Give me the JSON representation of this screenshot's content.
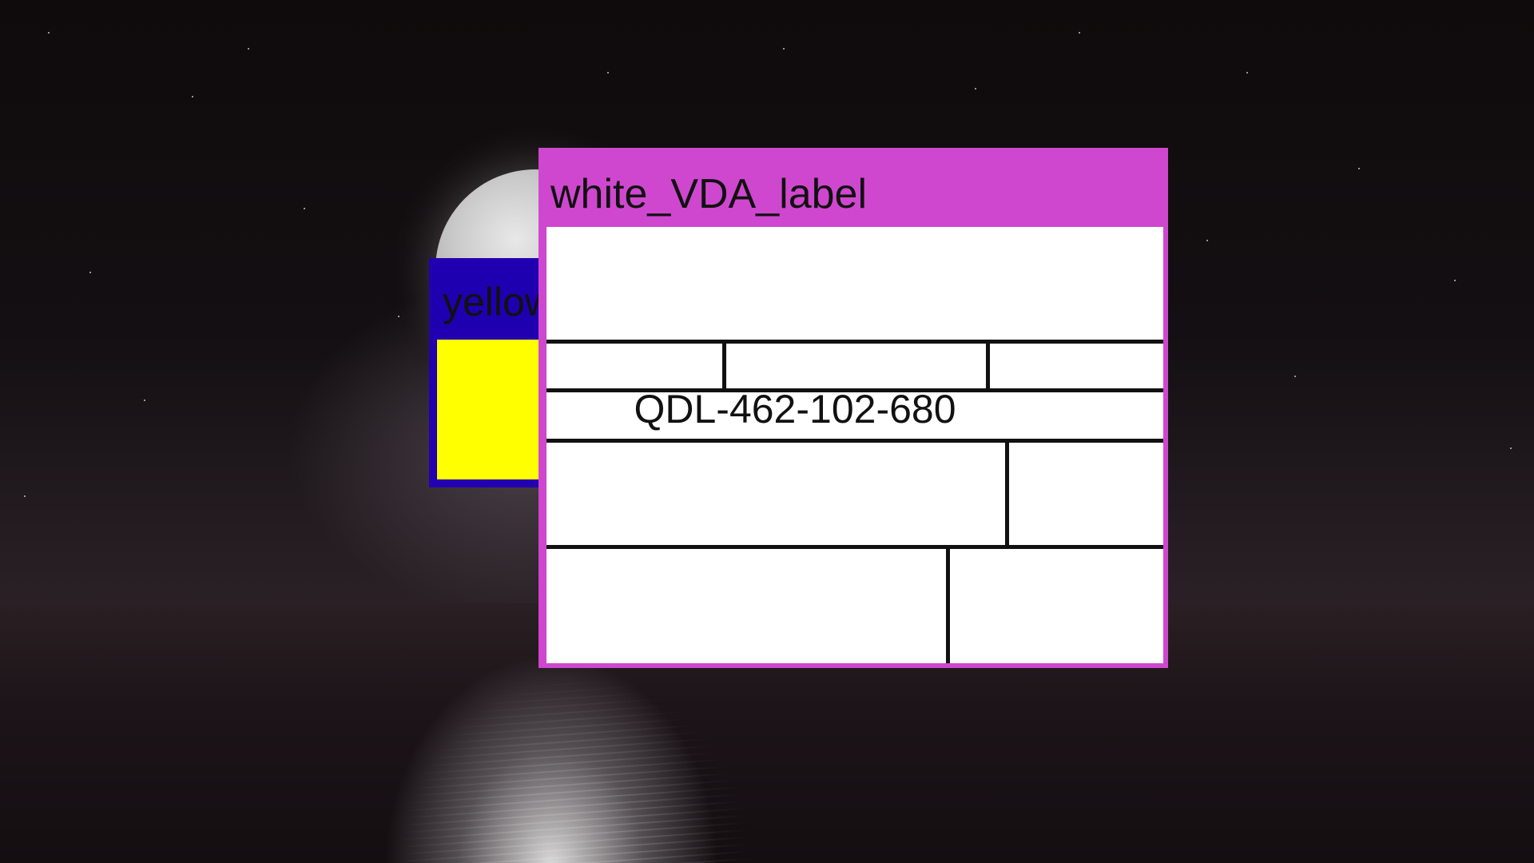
{
  "windows": {
    "back": {
      "title": "yellow_VDA_label",
      "title_color": "#1f00b0",
      "content_color": "#ffff00"
    },
    "front": {
      "title": "white_VDA_label",
      "frame_color": "#cf47cf",
      "content_color": "#ffffff",
      "label_code": "QDL-462-102-680"
    }
  },
  "desktop": {
    "wallpaper": "moon-over-sea"
  }
}
